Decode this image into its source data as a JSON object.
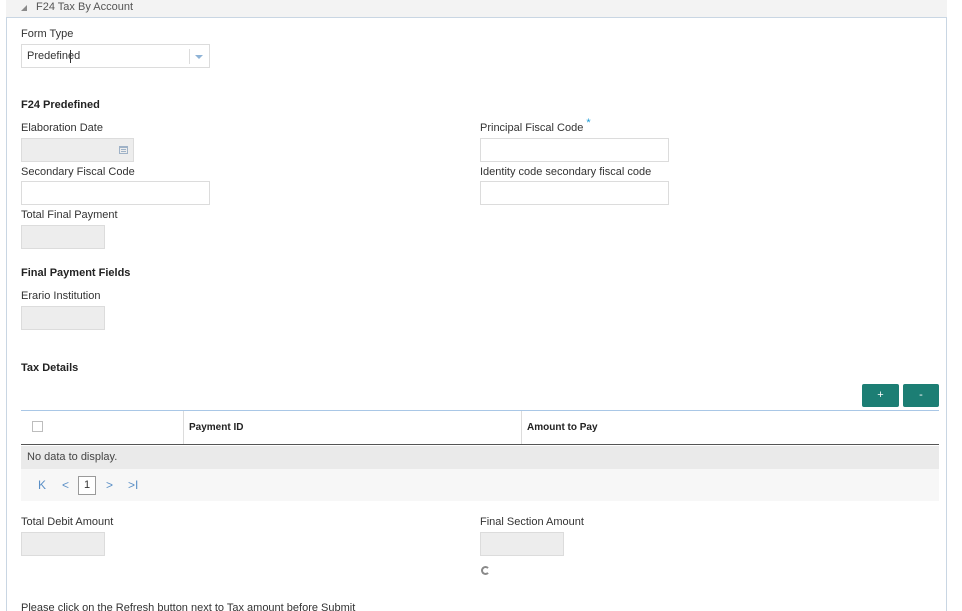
{
  "section": {
    "title": "F24 Tax By Account"
  },
  "form_type": {
    "label": "Form Type",
    "value": "Predefined"
  },
  "f24_predefined": {
    "heading": "F24 Predefined",
    "elaboration_date_label": "Elaboration Date",
    "principal_fiscal_code_label": "Principal Fiscal Code",
    "required_marker": "*",
    "secondary_fiscal_code_label": "Secondary Fiscal Code",
    "identity_code_label": "Identity code secondary fiscal code",
    "total_final_payment_label": "Total Final Payment"
  },
  "final_payment_fields": {
    "heading": "Final Payment Fields",
    "erario_institution_label": "Erario Institution"
  },
  "tax_details": {
    "heading": "Tax Details",
    "add_label": "+",
    "remove_label": "-",
    "columns": [
      "Payment ID",
      "Amount to Pay"
    ],
    "empty_text": "No data to display.",
    "pager": {
      "first": "K",
      "prev": "<",
      "page": "1",
      "next": ">",
      "last": ">I"
    }
  },
  "totals": {
    "total_debit_amount_label": "Total Debit Amount",
    "final_section_amount_label": "Final Section Amount"
  },
  "footer_note": "Please click on the Refresh button next to Tax amount before Submit",
  "colors": {
    "accent_button": "#1c7e74",
    "required": "#1a9ad6",
    "pager": "#5a8fc6"
  }
}
